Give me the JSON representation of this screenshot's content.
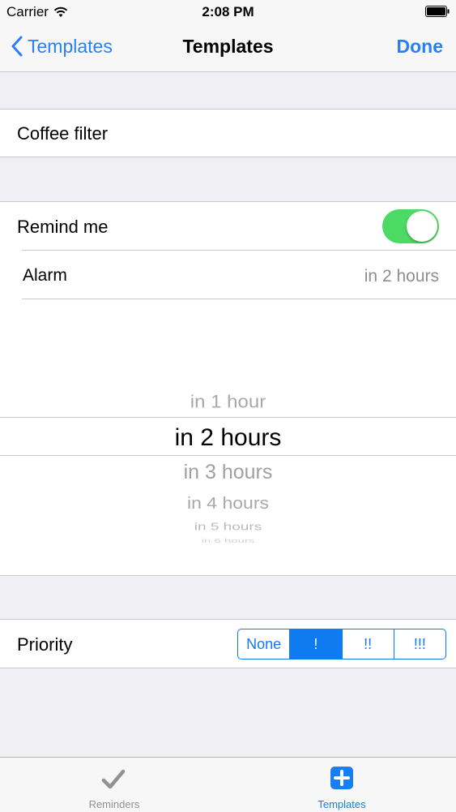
{
  "status": {
    "carrier": "Carrier",
    "time": "2:08 PM"
  },
  "nav": {
    "back_label": "Templates",
    "title": "Templates",
    "done_label": "Done"
  },
  "template": {
    "name": "Coffee filter"
  },
  "remind": {
    "label": "Remind me",
    "enabled": true
  },
  "alarm": {
    "label": "Alarm",
    "value": "in 2 hours"
  },
  "picker": {
    "options": [
      "in 1 hour",
      "in 2 hours",
      "in 3 hours",
      "in 4 hours",
      "in 5 hours",
      "in 6 hours"
    ],
    "selected": "in 2 hours"
  },
  "priority": {
    "label": "Priority",
    "options": [
      "None",
      "!",
      "!!",
      "!!!"
    ],
    "selected": "!"
  },
  "tabs": [
    {
      "label": "Reminders",
      "icon": "checkmark-icon",
      "active": false
    },
    {
      "label": "Templates",
      "icon": "plus-square-icon",
      "active": true
    }
  ],
  "colors": {
    "accent": "#0f7bf0",
    "toggle_on": "#4cd964",
    "background": "#efeff4"
  }
}
